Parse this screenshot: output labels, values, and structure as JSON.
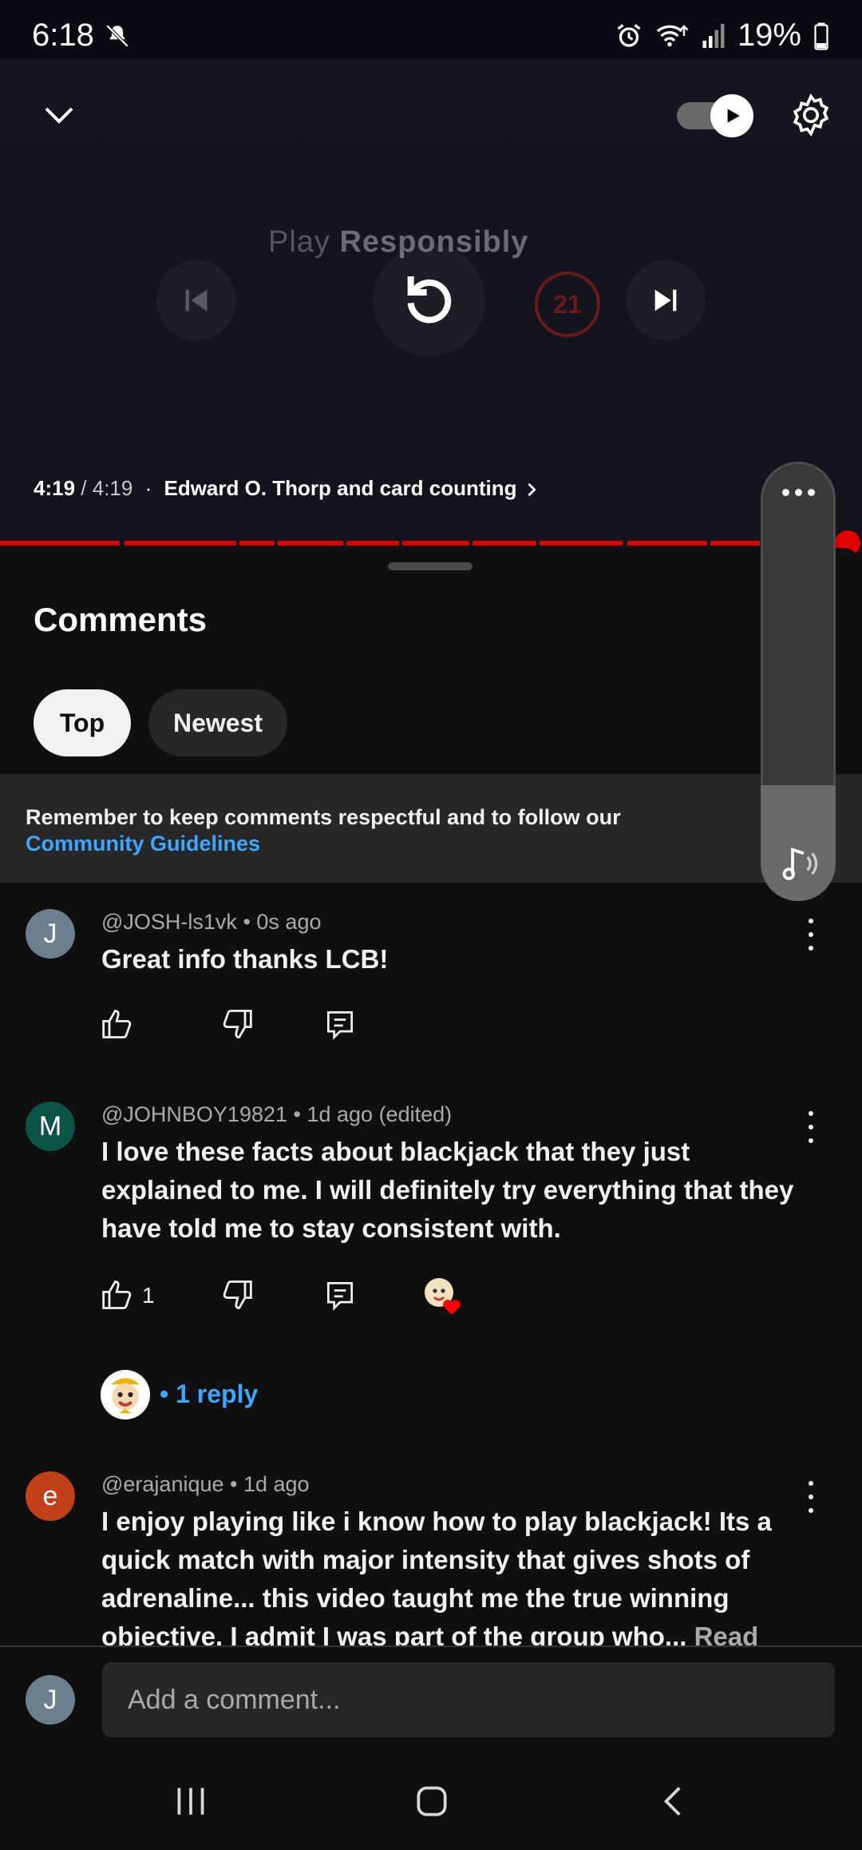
{
  "status_bar": {
    "time": "6:18",
    "battery": "19%"
  },
  "player": {
    "watermark_light": "Play ",
    "watermark_bold": "Responsibly",
    "age_badge": "21",
    "time_current": "4:19",
    "time_total": "4:19",
    "chapter_title": "Edward O. Thorp and card counting",
    "autoplay_on": true
  },
  "comments": {
    "title": "Comments",
    "tabs": [
      "Top",
      "Newest"
    ],
    "selected_tab": "Top",
    "banner_text": "Remember to keep comments respectful and to follow our ",
    "banner_link": "Community Guidelines",
    "items": [
      {
        "avatar_letter": "J",
        "avatar_color": "#6b7f8f",
        "author": "@JOSH-ls1vk",
        "time": "0s ago",
        "text": "Great info thanks LCB!",
        "likes": ""
      },
      {
        "avatar_letter": "M",
        "avatar_color": "#0b5345",
        "author": "@JOHNBOY19821",
        "time": "1d ago (edited)",
        "text": "I love these facts about blackjack that they just explained to me. I will definitely try everything that they have told me to stay consistent with.",
        "likes": "1",
        "replies_label": "• 1 reply"
      },
      {
        "avatar_letter": "e",
        "avatar_color": "#c0401a",
        "author": "@erajanique",
        "time": "1d ago",
        "text": "I enjoy playing like i know how to play blackjack! Its a quick match with major intensity that gives shots of adrenaline... this video taught me the true winning objective. I admit I was part of the group who... ",
        "read_more": "Read more"
      }
    ]
  },
  "composer": {
    "avatar_letter": "J",
    "placeholder": "Add a comment..."
  },
  "colors": {
    "accent": "#3ea6ff",
    "progress": "#e10000",
    "background": "#0f0f0f"
  }
}
